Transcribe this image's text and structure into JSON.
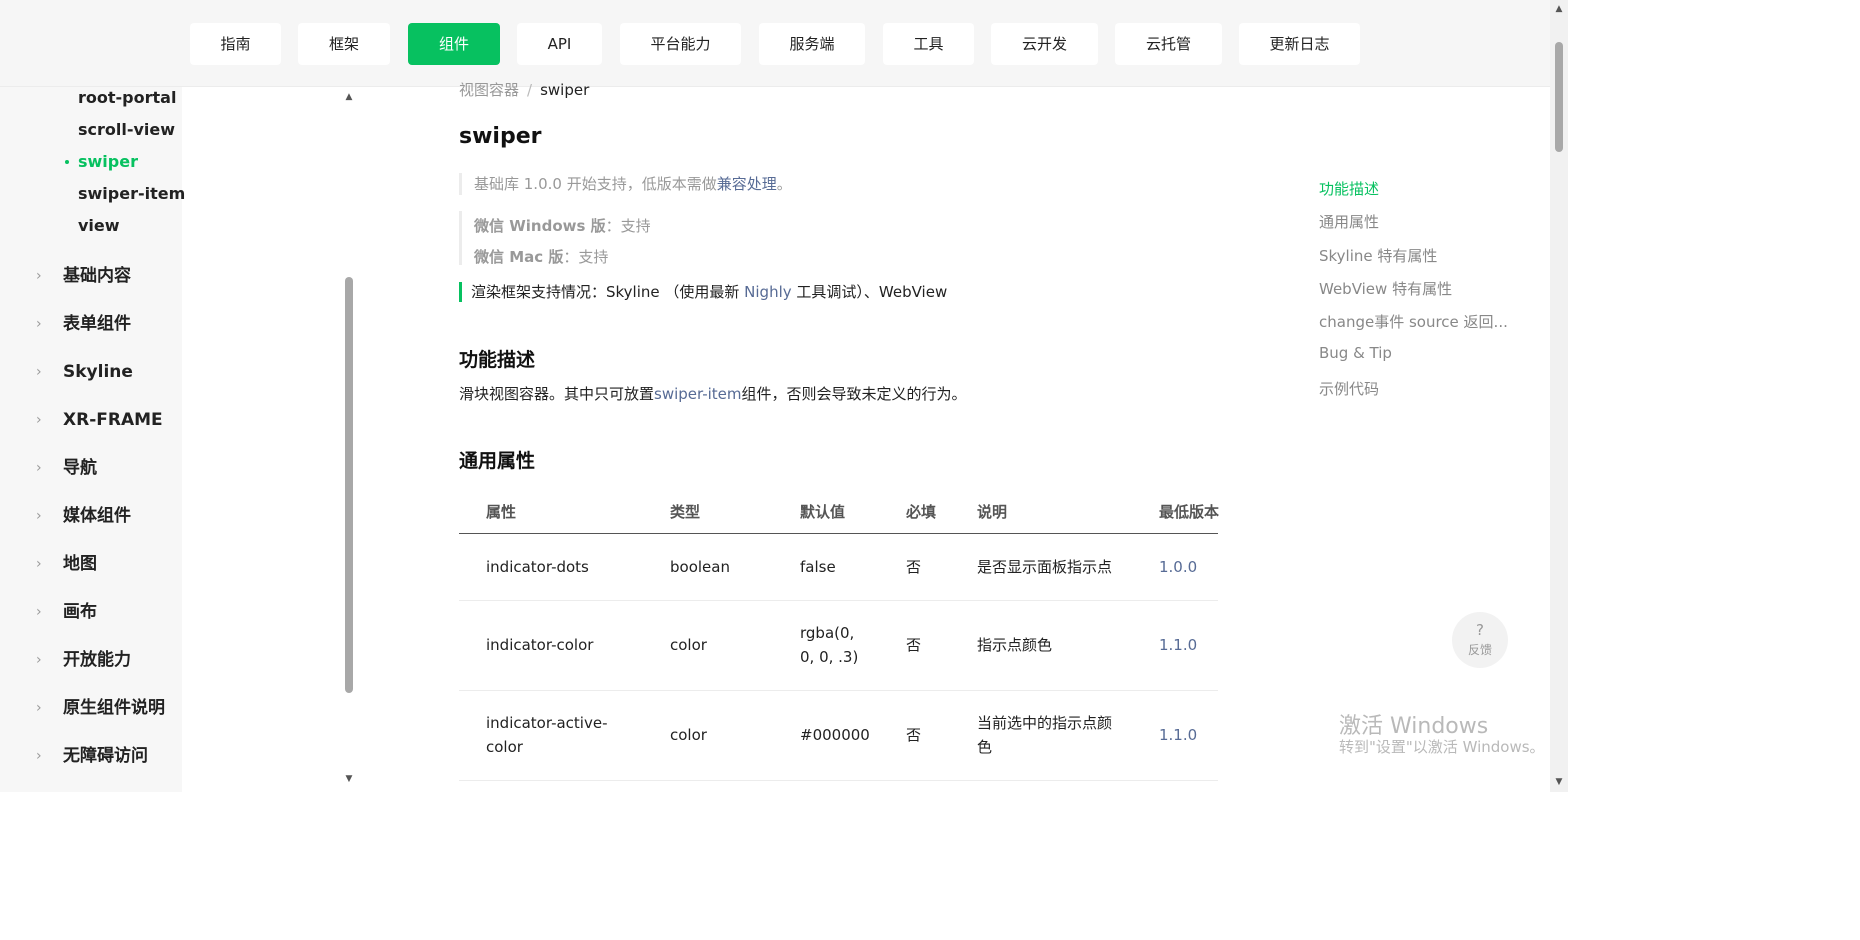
{
  "topnav": {
    "items": [
      {
        "label": "指南"
      },
      {
        "label": "框架"
      },
      {
        "label": "组件"
      },
      {
        "label": "API"
      },
      {
        "label": "平台能力"
      },
      {
        "label": "服务端"
      },
      {
        "label": "工具"
      },
      {
        "label": "云开发"
      },
      {
        "label": "云托管"
      },
      {
        "label": "更新日志"
      }
    ],
    "active_index": 2,
    "active_color": "#07c160"
  },
  "sidebar": {
    "subitems": [
      {
        "label": "root-portal"
      },
      {
        "label": "scroll-view"
      },
      {
        "label": "swiper"
      },
      {
        "label": "swiper-item"
      },
      {
        "label": "view"
      }
    ],
    "active_subitem": "swiper",
    "categories": [
      {
        "label": "基础内容"
      },
      {
        "label": "表单组件"
      },
      {
        "label": "Skyline"
      },
      {
        "label": "XR-FRAME"
      },
      {
        "label": "导航"
      },
      {
        "label": "媒体组件"
      },
      {
        "label": "地图"
      },
      {
        "label": "画布"
      },
      {
        "label": "开放能力"
      },
      {
        "label": "原生组件说明"
      },
      {
        "label": "无障碍访问"
      }
    ],
    "chevron": "›"
  },
  "breadcrumb": {
    "parent": "视图容器",
    "separator": "/",
    "current": "swiper"
  },
  "page": {
    "title": "swiper",
    "support_prefix": "基础库 1.0.0 开始支持，低版本需做",
    "support_link": "兼容处理",
    "support_suffix": "。",
    "windows_label": "微信 Windows 版",
    "windows_value": "：支持",
    "mac_label": "微信 Mac 版",
    "mac_value": "：支持",
    "render_prefix": "渲染框架支持情况：Skyline （使用最新 ",
    "render_link": "Nighly",
    "render_suffix": " 工具调试）、WebView",
    "section1_title": "功能描述",
    "desc_prefix": "滑块视图容器。其中只可放置",
    "desc_link": "swiper-item",
    "desc_suffix": "组件，否则会导致未定义的行为。",
    "section2_title": "通用属性"
  },
  "table": {
    "headers": {
      "attr": "属性",
      "type": "类型",
      "default": "默认值",
      "required": "必填",
      "desc": "说明",
      "version": "最低版本"
    },
    "rows": [
      {
        "attr": "indicator-dots",
        "type": "boolean",
        "default": "false",
        "required": "否",
        "desc": "是否显示面板指示点",
        "version": "1.0.0"
      },
      {
        "attr": "indicator-color",
        "type": "color",
        "default": "rgba(0, 0, 0, .3)",
        "required": "否",
        "desc": "指示点颜色",
        "version": "1.1.0"
      },
      {
        "attr": "indicator-active-color",
        "type": "color",
        "default": "#000000",
        "required": "否",
        "desc": "当前选中的指示点颜色",
        "version": "1.1.0"
      }
    ]
  },
  "toc": {
    "items": [
      {
        "label": "功能描述"
      },
      {
        "label": "通用属性"
      },
      {
        "label": "Skyline 特有属性"
      },
      {
        "label": "WebView 特有属性"
      },
      {
        "label": "change事件 source 返回..."
      },
      {
        "label": "Bug & Tip"
      },
      {
        "label": "示例代码"
      }
    ],
    "active": "功能描述"
  },
  "feedback": {
    "icon": "?",
    "label": "反馈"
  },
  "watermark": {
    "line1": "激活 Windows",
    "line2": "转到\"设置\"以激活 Windows。"
  },
  "colors": {
    "accent": "#07c160",
    "link": "#576b95"
  }
}
